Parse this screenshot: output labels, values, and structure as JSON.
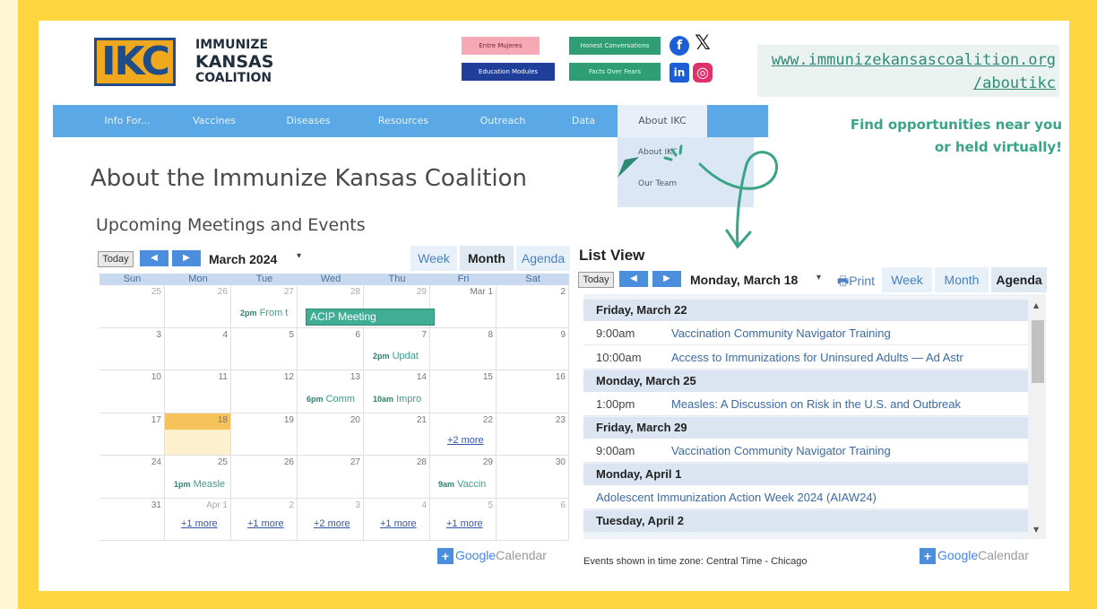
{
  "brand": {
    "logo_letters": "IKC",
    "name_line1": "IMMUNIZE",
    "name_line2": "KANSAS",
    "name_line3": "COALITION"
  },
  "header_buttons": [
    {
      "label": "Entre Mujeres",
      "color": "#f4a9b4"
    },
    {
      "label": "Education Modules",
      "color": "#1f3f9a"
    },
    {
      "label": "Honest Conversations",
      "color": "#2f9e74"
    },
    {
      "label": "Facts Over Fears",
      "color": "#2f9e74"
    }
  ],
  "social": {
    "facebook": "f",
    "x": "𝕏",
    "linkedin": "in",
    "instagram": "◎"
  },
  "promo": {
    "url_line1": "www.immunizekansascoalition.org",
    "url_line2": "/aboutikc",
    "find_line1": "Find opportunities near you",
    "find_line2": "or held virtually!"
  },
  "nav": {
    "items": [
      "Info For...",
      "Vaccines",
      "Diseases",
      "Resources",
      "Outreach",
      "Data",
      "About IKC"
    ],
    "dropdown": [
      "About IKC",
      "Our Team"
    ]
  },
  "page": {
    "title": "About the Immunize Kansas Coalition",
    "subtitle": "Upcoming Meetings and Events"
  },
  "calendar": {
    "today": "Today",
    "month_label": "March 2024",
    "tabs": [
      "Week",
      "Month",
      "Agenda"
    ],
    "days_of_week": [
      "Sun",
      "Mon",
      "Tue",
      "Wed",
      "Thu",
      "Fri",
      "Sat"
    ],
    "weeks": [
      [
        "25",
        "26",
        "27",
        "28",
        "29",
        "Mar 1",
        "2"
      ],
      [
        "3",
        "4",
        "5",
        "6",
        "7",
        "8",
        "9"
      ],
      [
        "10",
        "11",
        "12",
        "13",
        "14",
        "15",
        "16"
      ],
      [
        "17",
        "18",
        "19",
        "20",
        "21",
        "22",
        "23"
      ],
      [
        "24",
        "25",
        "26",
        "27",
        "28",
        "29",
        "30"
      ],
      [
        "31",
        "Apr 1",
        "2",
        "3",
        "4",
        "5",
        "6"
      ]
    ],
    "events": {
      "w0_tue_time": "2pm",
      "w0_tue_title": "From t",
      "w0_acip": "ACIP Meeting",
      "w1_thu_time": "2pm",
      "w1_thu_title": "Updat",
      "w2_wed_time": "6pm",
      "w2_wed_title": "Comm",
      "w2_thu_time": "10am",
      "w2_thu_title": "Impro",
      "w3_fri_more": "+2 more",
      "w4_mon_time": "1pm",
      "w4_mon_title": "Measle",
      "w4_fri_time": "9am",
      "w4_fri_title": "Vaccin",
      "w5_more": [
        "+1 more",
        "+1 more",
        "+2 more",
        "+1 more",
        "+1 more"
      ]
    },
    "gcal": {
      "google": "Google",
      "calendar": "Calendar"
    }
  },
  "list_view": {
    "title": "List View",
    "today": "Today",
    "date_label": "Monday, March 18",
    "print": "Print",
    "tabs": [
      "Week",
      "Month",
      "Agenda"
    ],
    "agenda": [
      {
        "day": "Friday, March 22"
      },
      {
        "time": "9:00am",
        "title": "Vaccination Community Navigator Training"
      },
      {
        "time": "10:00am",
        "title": "Access to Immunizations for Uninsured Adults — Ad Astr"
      },
      {
        "day": "Monday, March 25"
      },
      {
        "time": "1:00pm",
        "title": "Measles: A Discussion on Risk in the U.S. and Outbreak"
      },
      {
        "day": "Friday, March 29"
      },
      {
        "time": "9:00am",
        "title": "Vaccination Community Navigator Training"
      },
      {
        "day": "Monday, April 1"
      },
      {
        "time": "",
        "title": "Adolescent Immunization Action Week 2024 (AIAW24)"
      },
      {
        "day": "Tuesday, April 2"
      }
    ],
    "timezone": "Events shown in time zone: Central Time - Chicago",
    "gcal": {
      "google": "Google",
      "calendar": "Calendar"
    }
  }
}
